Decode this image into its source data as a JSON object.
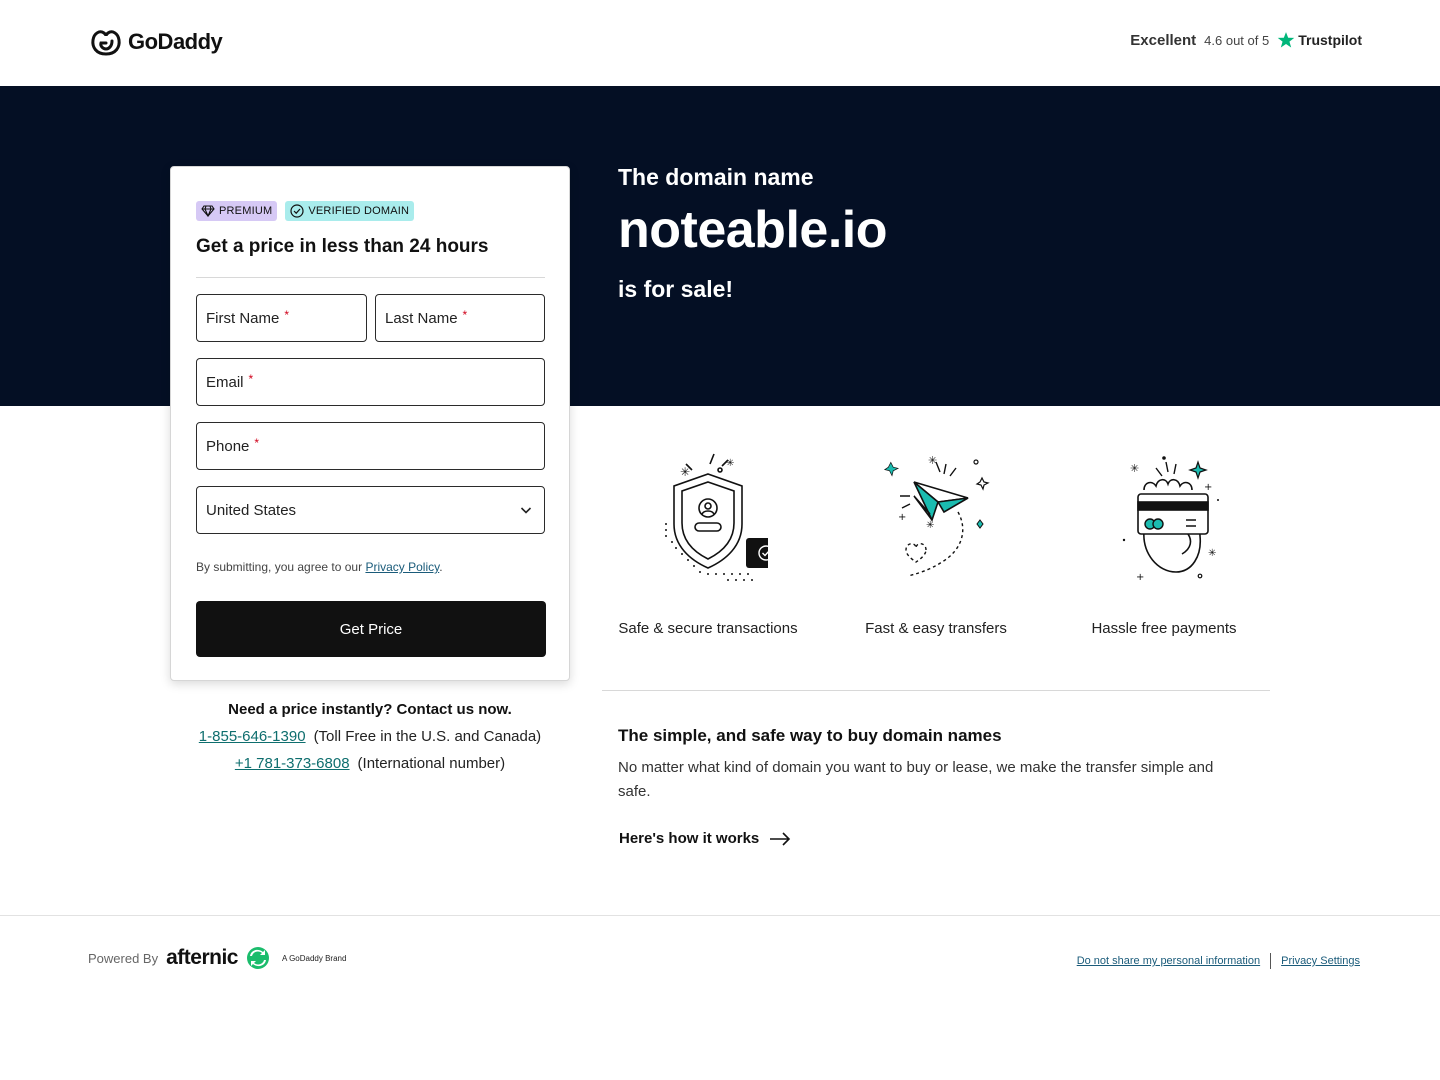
{
  "header": {
    "logo_text": "GoDaddy",
    "rating_word": "Excellent",
    "rating_score": "4.6 out of 5",
    "trustpilot": "Trustpilot"
  },
  "hero": {
    "line1": "The domain name",
    "domain": "noteable.io",
    "line3": "is for sale!"
  },
  "form": {
    "badge_premium": "PREMIUM",
    "badge_verified": "VERIFIED DOMAIN",
    "title": "Get a price in less than 24 hours",
    "first_name": "First Name",
    "last_name": "Last Name",
    "email": "Email",
    "phone": "Phone",
    "country": "United States",
    "required_mark": "*",
    "legal_prefix": "By submitting, you agree to our ",
    "privacy_link": "Privacy Policy",
    "legal_suffix": ".",
    "submit": "Get Price"
  },
  "contact": {
    "heading": "Need a price instantly? Contact us now.",
    "phone1": "1-855-646-1390",
    "phone1_note": "(Toll Free in the U.S. and Canada)",
    "phone2": "+1 781-373-6808",
    "phone2_note": "(International number)"
  },
  "features": [
    {
      "label": "Safe & secure transactions",
      "icon": "shield-icon"
    },
    {
      "label": "Fast & easy transfers",
      "icon": "paper-plane-icon"
    },
    {
      "label": "Hassle free payments",
      "icon": "card-payment-icon"
    }
  ],
  "info": {
    "heading": "The simple, and safe way to buy domain names",
    "body": "No matter what kind of domain you want to buy or lease, we make the transfer simple and safe.",
    "link": "Here's how it works"
  },
  "footer": {
    "powered_by": "Powered By",
    "afternic": "afternic",
    "gd_brand": "A GoDaddy Brand",
    "link_do_not_share": "Do not share my personal information",
    "link_privacy_settings": "Privacy Settings"
  },
  "colors": {
    "hero_bg": "#040f24",
    "button_bg": "#111111",
    "premium_badge": "#d6c9f5",
    "verified_badge": "#a9ecec",
    "link_teal": "#0e6e6e",
    "accent_teal": "#1bbcb0",
    "trustpilot_green": "#00b67a"
  }
}
